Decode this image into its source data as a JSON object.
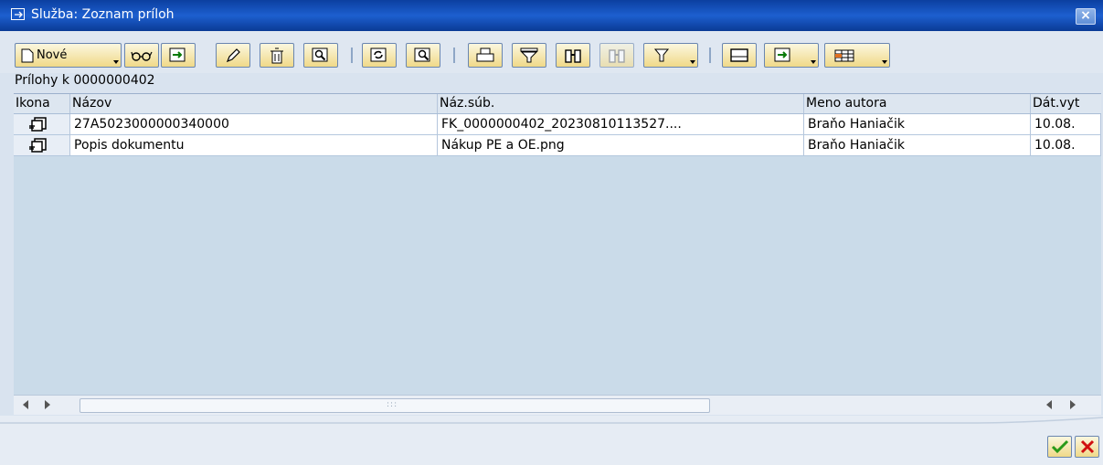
{
  "window": {
    "title": "Služba: Zoznam príloh",
    "close_label": "×"
  },
  "toolbar": {
    "new_label": "Nové",
    "buttons": [
      "new",
      "view",
      "export",
      "edit",
      "delete",
      "search-details",
      "refresh",
      "find",
      "print",
      "filter",
      "find-binoculars",
      "find-next",
      "set-filter",
      "print-preview",
      "export-list",
      "layout"
    ]
  },
  "subtitle": "Prílohy k 0000000402",
  "table": {
    "columns": [
      "Ikona",
      "Názov",
      "Náz.súb.",
      "Meno autora",
      "Dát.vyt"
    ],
    "rows": [
      {
        "name": "27A5023000000340000",
        "file": "FK_0000000402_20230810113527....",
        "author": "Braňo Haniačik",
        "date": "10.08."
      },
      {
        "name": "Popis dokumentu",
        "file": "Nákup PE a OE.png",
        "author": "Braňo Haniačik",
        "date": "10.08."
      }
    ]
  },
  "scrollbar": {
    "grip": ":::"
  },
  "colors": {
    "title_bar": "#1d5fcf",
    "button_face": "#f0d988",
    "table_bg": "#cadbe9"
  }
}
